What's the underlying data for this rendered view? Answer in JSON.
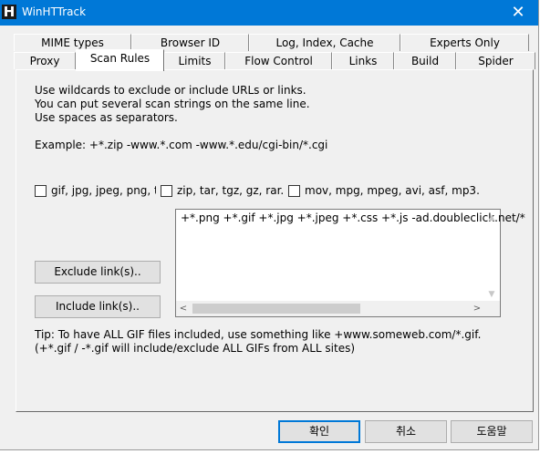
{
  "window": {
    "title": "WinHTTrack",
    "icon_letter": "H",
    "close_glyph": "✕"
  },
  "tabs": {
    "row1": [
      "MIME types",
      "Browser ID",
      "Log, Index, Cache",
      "Experts Only"
    ],
    "row2": [
      "Proxy",
      "Scan Rules",
      "Limits",
      "Flow Control",
      "Links",
      "Build",
      "Spider"
    ],
    "active": "Scan Rules"
  },
  "scan_rules": {
    "instructions": [
      "Use wildcards to exclude or include URLs or links.",
      "You can put several scan strings on the same line.",
      "Use spaces as separators."
    ],
    "example": "Example: +*.zip -www.*.com -www.*.edu/cgi-bin/*.cgi",
    "checkboxes": [
      {
        "label": "gif, jpg, jpeg, png, tif",
        "checked": false
      },
      {
        "label": "zip, tar, tgz, gz, rar.",
        "checked": false
      },
      {
        "label": "mov, mpg, mpeg, avi, asf, mp3.",
        "checked": false
      }
    ],
    "rules_value": "+*.png +*.gif +*.jpg +*.jpeg +*.css +*.js -ad.doubleclick.net/*",
    "exclude_button": "Exclude link(s)..",
    "include_button": "Include link(s)..",
    "tip_line1": "Tip: To have ALL GIF files included, use something like +www.someweb.com/*.gif.",
    "tip_line2": "(+*.gif / -*.gif will include/exclude ALL GIFs from ALL sites)"
  },
  "footer": {
    "ok": "확인",
    "cancel": "취소",
    "help": "도움말"
  },
  "icons": {
    "scroll_up": "▲",
    "scroll_down": "▼",
    "scroll_left": "<",
    "scroll_right": ">"
  }
}
